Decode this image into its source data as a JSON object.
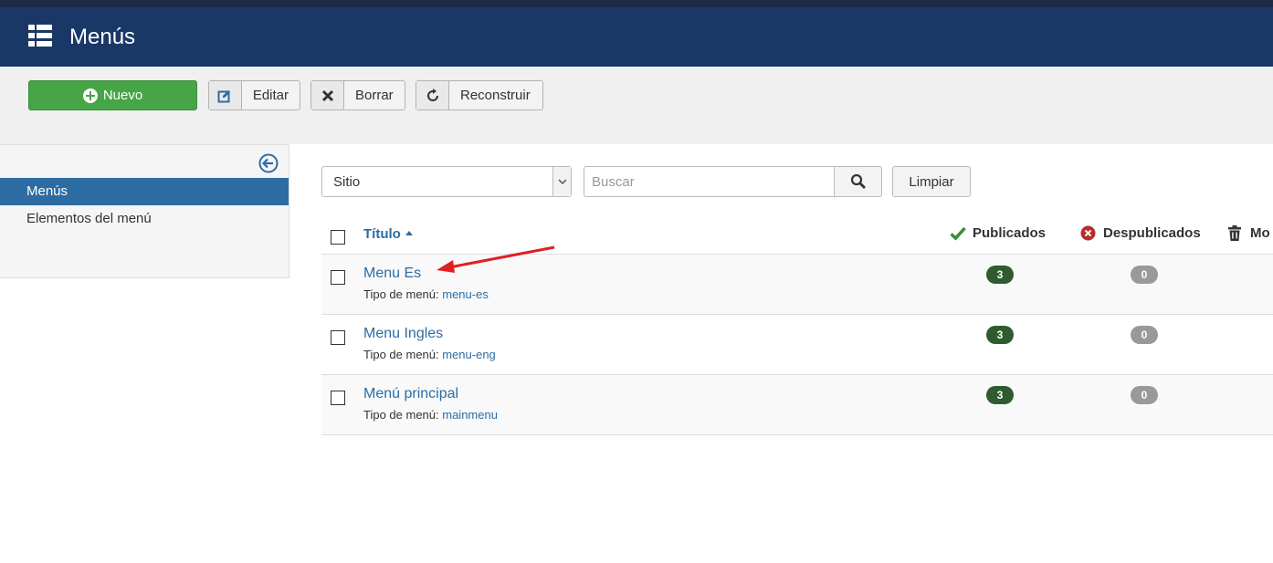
{
  "header": {
    "title": "Menús",
    "icon": "list-icon"
  },
  "toolbar": {
    "new_label": "Nuevo",
    "edit_label": "Editar",
    "delete_label": "Borrar",
    "rebuild_label": "Reconstruir"
  },
  "sidebar": {
    "items": [
      {
        "label": "Menús",
        "active": true
      },
      {
        "label": "Elementos del menú",
        "active": false
      }
    ]
  },
  "filters": {
    "client_select": "Sitio",
    "search_placeholder": "Buscar",
    "clear_label": "Limpiar"
  },
  "table": {
    "headers": {
      "title": "Título",
      "published": "Publicados",
      "unpublished": "Despublicados",
      "trashed": "Mo"
    },
    "type_prefix": "Tipo de menú:",
    "rows": [
      {
        "title": "Menu Es",
        "type": "menu-es",
        "published": "3",
        "unpublished": "0"
      },
      {
        "title": "Menu Ingles",
        "type": "menu-eng",
        "published": "3",
        "unpublished": "0"
      },
      {
        "title": "Menú principal",
        "type": "mainmenu",
        "published": "3",
        "unpublished": "0"
      }
    ]
  },
  "colors": {
    "header_bg": "#1a3867",
    "new_button": "#46a546",
    "active_sidebar": "#2d6ca2",
    "badge_published": "#2f5b2f",
    "badge_unpublished": "#999999",
    "annotation_arrow": "#e02020"
  }
}
